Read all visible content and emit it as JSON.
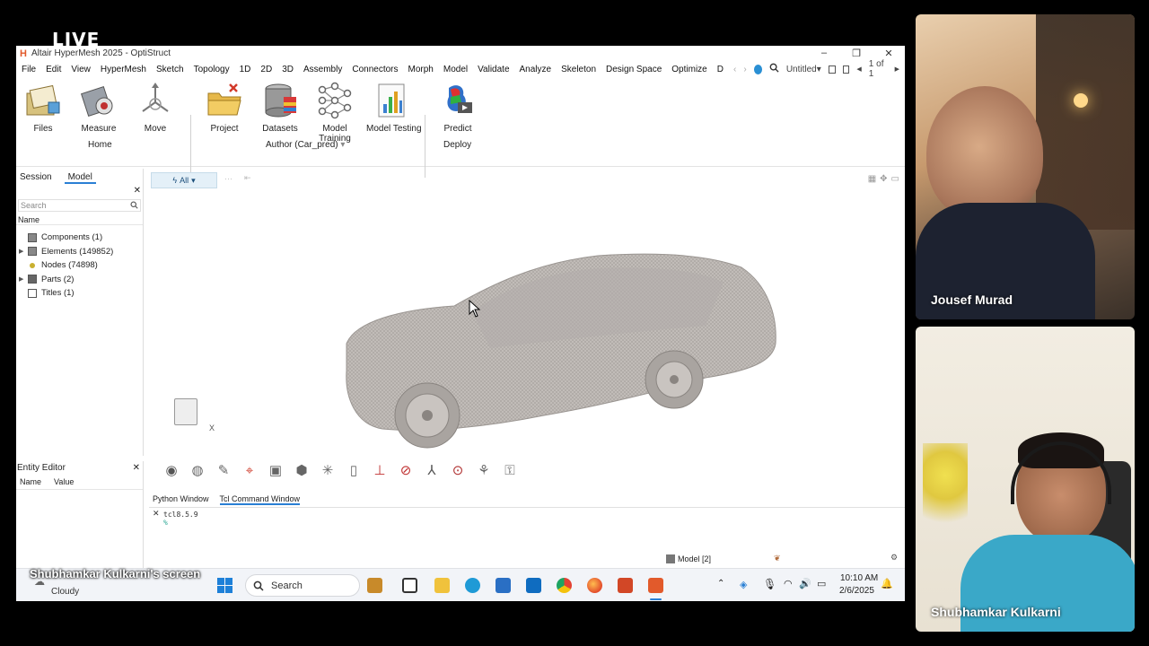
{
  "stream": {
    "live_label": "LIVE",
    "shared_screen_label": "Shubhamkar Kulkarni's screen"
  },
  "app": {
    "title": "Altair HyperMesh 2025 - OptiStruct",
    "window_controls": [
      "–",
      "❐",
      "✕"
    ],
    "menu": [
      "File",
      "Edit",
      "View",
      "HyperMesh",
      "Sketch",
      "Topology",
      "1D",
      "2D",
      "3D",
      "Assembly",
      "Connectors",
      "Morph",
      "Model",
      "Validate",
      "Analyze",
      "Skeleton",
      "Design Space",
      "Optimize",
      "D"
    ],
    "doc_title": "Untitled",
    "page_indicator": "1 of 1"
  },
  "ribbon": {
    "home_tools": [
      "Files",
      "Measure",
      "Move"
    ],
    "home_group": "Home",
    "author_tools": [
      "Project",
      "Datasets",
      "Model Training",
      "Model Testing"
    ],
    "author_group": "Author (Car_pred)",
    "deploy_tools": [
      "Predict"
    ],
    "deploy_group": "Deploy"
  },
  "panel": {
    "tabs": [
      "Session",
      "Model"
    ],
    "search_placeholder": "Search",
    "name_header": "Name",
    "tree": [
      {
        "label": "Components (1)",
        "expandable": false,
        "icon": "component-icon"
      },
      {
        "label": "Elements (149852)",
        "expandable": true,
        "icon": "element-icon"
      },
      {
        "label": "Nodes (74898)",
        "expandable": false,
        "icon": "node-icon"
      },
      {
        "label": "Parts (2)",
        "expandable": true,
        "icon": "part-icon"
      },
      {
        "label": "Titles (1)",
        "expandable": false,
        "icon": "title-icon"
      }
    ]
  },
  "entity_editor": {
    "title": "Entity Editor",
    "columns": [
      "Name",
      "Value"
    ]
  },
  "viewport": {
    "filter_label": "All",
    "axis_label": "X"
  },
  "console": {
    "tabs": [
      "Python Window",
      "Tcl Command Window"
    ],
    "lines": [
      "tcl8.5.9",
      "%"
    ]
  },
  "statusbar": {
    "model_label": "Model [2]"
  },
  "taskbar": {
    "weather": "Cloudy",
    "search": "Search",
    "time": "10:10 AM",
    "date": "2/6/2025"
  },
  "participants": [
    {
      "name": "Jousef Murad"
    },
    {
      "name": "Shubhamkar Kulkarni"
    }
  ],
  "colors": {
    "accent": "#2a7fd4",
    "brand": "#e25a2b",
    "mesh": "#b3aeaa"
  }
}
